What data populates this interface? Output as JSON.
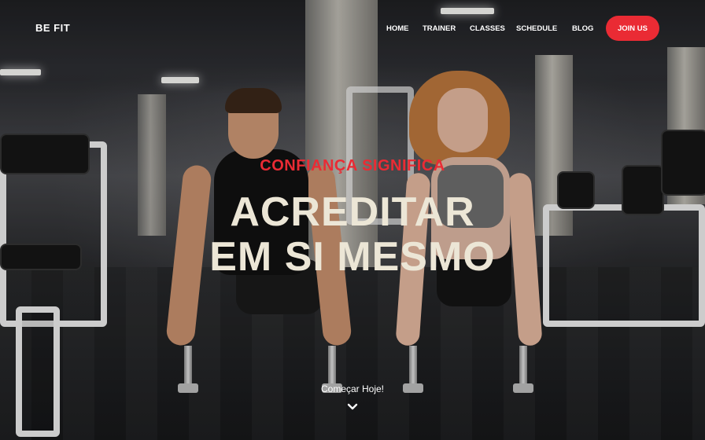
{
  "brand": {
    "logo": "BE FIT"
  },
  "nav": {
    "items": [
      "HOME",
      "TRAINER",
      "CLASSES",
      "SCHEDULE",
      "BLOG"
    ],
    "join_label": "JOIN US"
  },
  "hero": {
    "kicker": "CONFIANÇA SIGNIFICA",
    "headline_line1": "ACREDITAR",
    "headline_line2": "EM SI MESMO",
    "cta": "Começar Hoje!",
    "scroll_icon": "chevron-down-icon"
  },
  "colors": {
    "accent": "#ea2b34",
    "headline": "#ece6d6",
    "text": "#ffffff"
  }
}
